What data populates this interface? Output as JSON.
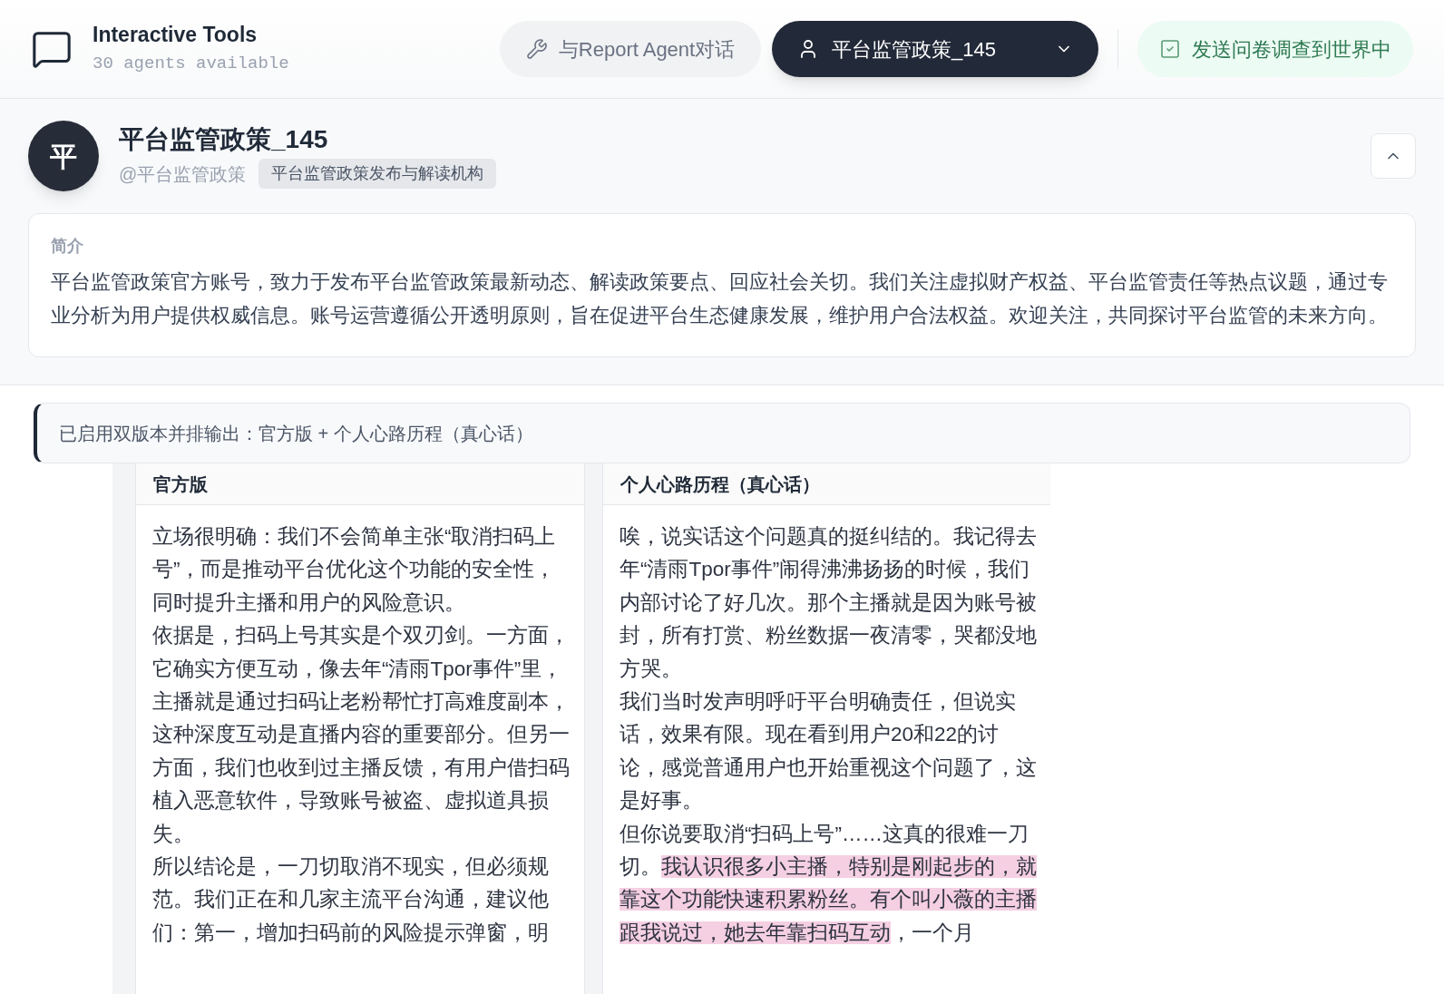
{
  "header": {
    "title": "Interactive Tools",
    "subtitle": "30 agents available",
    "report_button": "与Report Agent对话",
    "agent_select": "平台监管政策_145",
    "survey_button": "发送问卷调查到世界中"
  },
  "profile": {
    "avatar": "平",
    "name": "平台监管政策_145",
    "handle": "@平台监管政策",
    "tag": "平台监管政策发布与解读机构",
    "expanded": true,
    "bio_label": "简介",
    "bio": "平台监管政策官方账号，致力于发布平台监管政策最新动态、解读政策要点、回应社会关切。我们关注虚拟财产权益、平台监管责任等热点议题，通过专业分析为用户提供权威信息。账号运营遵循公开透明原则，旨在促进平台生态健康发展，维护用户合法权益。欢迎关注，共同探讨平台监管的未来方向。"
  },
  "notice": "已启用双版本并排输出：官方版 + 个人心路历程（真心话）",
  "columns": [
    {
      "title": "官方版",
      "paragraphs": [
        [
          {
            "text": "立场很明确：我们不会简单主张“取消扫码上号”，而是推动平台优化这个功能的安全性，同时提升主播和用户的风险意识。",
            "highlighted": false
          }
        ],
        [
          {
            "text": "依据是，扫码上号其实是个双刃剑。一方面，它确实方便互动，像去年“清雨Tpor事件”里，主播就是通过扫码让老粉帮忙打高难度副本，这种深度互动是直播内容的重要部分。但另一方面，我们也收到过主播反馈，有用户借扫码植入恶意软件，导致账号被盗、虚拟道具损失。",
            "highlighted": false
          }
        ],
        [
          {
            "text": "所以结论是，一刀切取消不现实，但必须规范。我们正在和几家主流平台沟通，建议他们：第一，增加扫码前的风险提示弹窗，明",
            "highlighted": false
          }
        ]
      ]
    },
    {
      "title": "个人心路历程（真心话）",
      "paragraphs": [
        [
          {
            "text": "唉，说实话这个问题真的挺纠结的。我记得去年“清雨Tpor事件”闹得沸沸扬扬的时候，我们内部讨论了好几次。那个主播就是因为账号被封，所有打赏、粉丝数据一夜清零，哭都没地方哭。",
            "highlighted": false
          }
        ],
        [
          {
            "text": "我们当时发声明呼吁平台明确责任，但说实话，效果有限。现在看到用户20和22的讨论，感觉普通用户也开始重视这个问题了，这是好事。",
            "highlighted": false
          }
        ],
        [
          {
            "text": "但你说要取消“扫码上号”……这真的很难一刀切。",
            "highlighted": false
          },
          {
            "text": "我认识很多小主播，特别是刚起步的，就靠这个功能快速积累粉丝。有个叫小薇的主播跟我说过，她去年靠扫码互动",
            "highlighted": true
          },
          {
            "text": "，一个月",
            "highlighted": false
          }
        ]
      ]
    }
  ]
}
